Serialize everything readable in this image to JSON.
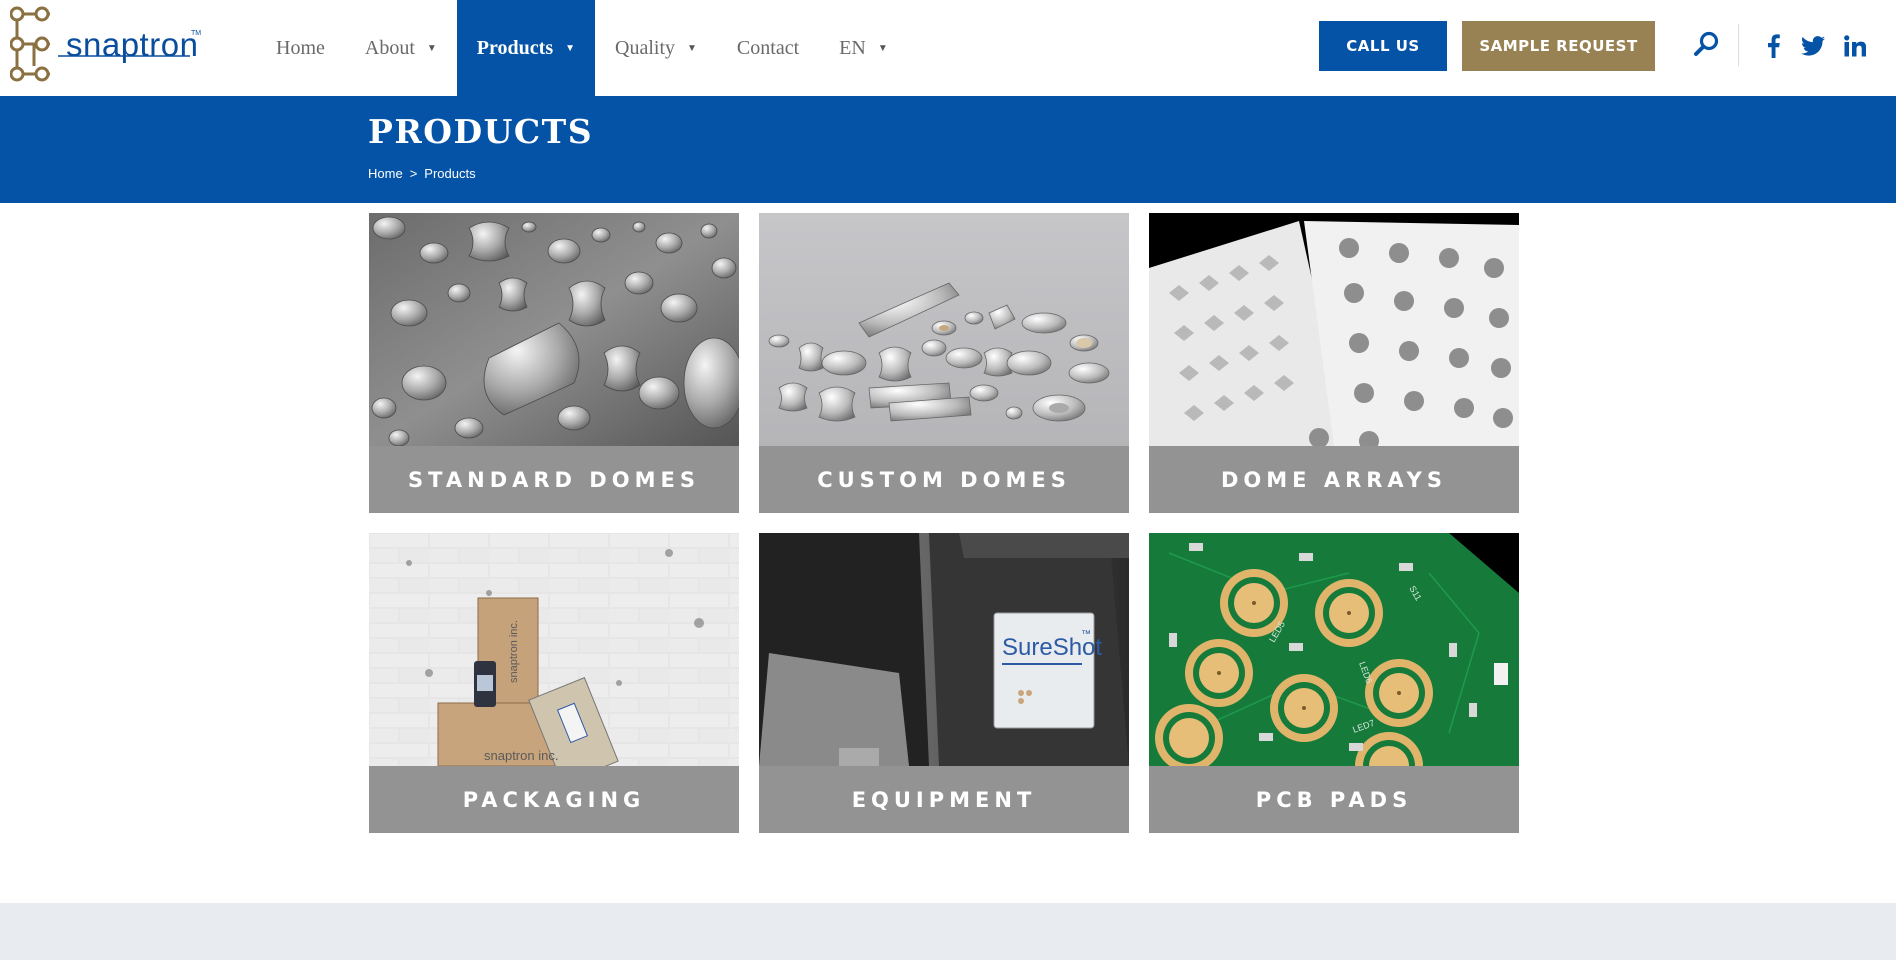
{
  "brand": {
    "name": "snaptron",
    "tm": "TM",
    "color": "#0a4d9e",
    "accent": "#8b7042"
  },
  "nav": {
    "items": [
      {
        "label": "Home",
        "caret": ""
      },
      {
        "label": "About",
        "caret": "▼"
      },
      {
        "label": "Products",
        "caret": "▼",
        "active": true
      },
      {
        "label": "Quality",
        "caret": "▼"
      },
      {
        "label": "Contact",
        "caret": ""
      },
      {
        "label": "EN",
        "caret": "▼"
      }
    ]
  },
  "header": {
    "call_label": "CALL US",
    "sample_label": "SAMPLE REQUEST",
    "search_icon": "search-icon",
    "social": [
      "facebook-icon",
      "twitter-icon",
      "linkedin-icon"
    ]
  },
  "banner": {
    "title": "PRODUCTS",
    "breadcrumb": {
      "home": "Home",
      "sep": ">",
      "current": "Products"
    }
  },
  "products": [
    {
      "label": "STANDARD DOMES"
    },
    {
      "label": "CUSTOM DOMES"
    },
    {
      "label": "DOME ARRAYS"
    },
    {
      "label": "PACKAGING"
    },
    {
      "label": "EQUIPMENT"
    },
    {
      "label": "PCB PADS"
    }
  ],
  "images": {
    "equipment_label": "SureShot",
    "equipment_tm": "™",
    "box_label": "snaptron inc.",
    "pcb_labels": [
      "LED5",
      "LED6",
      "LED7",
      "S11"
    ]
  },
  "colors": {
    "primary_blue": "#0553a6",
    "gold": "#988253",
    "caption_gray": "#939393",
    "footer_band": "#e8ebef"
  }
}
